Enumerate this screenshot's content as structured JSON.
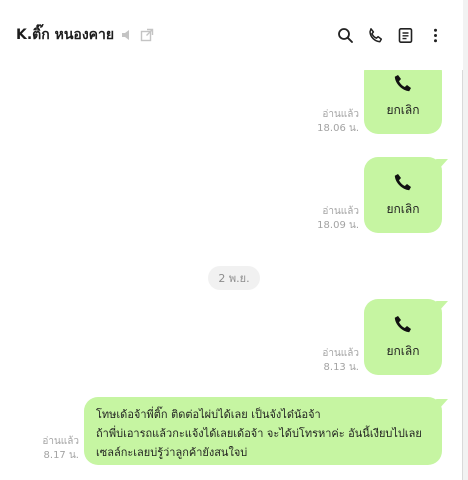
{
  "header": {
    "title": "K.ติ๊ก หนองคาย"
  },
  "messages": [
    {
      "type": "call",
      "label": "ยกเลิก",
      "read": "อ่านแล้ว",
      "time": "18.06 น."
    },
    {
      "type": "call",
      "label": "ยกเลิก",
      "read": "อ่านแล้ว",
      "time": "18.09 น."
    },
    {
      "type": "call",
      "label": "ยกเลิก",
      "read": "อ่านแล้ว",
      "time": "8.13 น."
    },
    {
      "type": "text",
      "lines": [
        "โทษเด้อจ้าพี่ติ๊ก  ติดต่อไผ่บ่ได้เลย  เป็นจังได๋น้อจ้า",
        "ถ้าพี่บ่เอารถแล้วกะแจ้งได้เลยเด้อจ้า  จะได้บ่โทรหาค่ะ  อันนี้เงียบไปเลย",
        "เซลล์กะเลยบ่รู้ว่าลูกค้ายังสนใจบ่"
      ],
      "read": "อ่านแล้ว",
      "time": "8.17 น."
    }
  ],
  "date_separator": "2 พ.ย.",
  "colors": {
    "bubble": "#c6f5a2",
    "meta_text": "#a3a3a3",
    "date_chip": "#f1f1f1"
  },
  "icons": {
    "header": [
      "speaker-mute-icon",
      "popout-icon",
      "search-icon",
      "phone-icon",
      "notes-icon",
      "more-icon"
    ],
    "call": "phone-icon"
  }
}
